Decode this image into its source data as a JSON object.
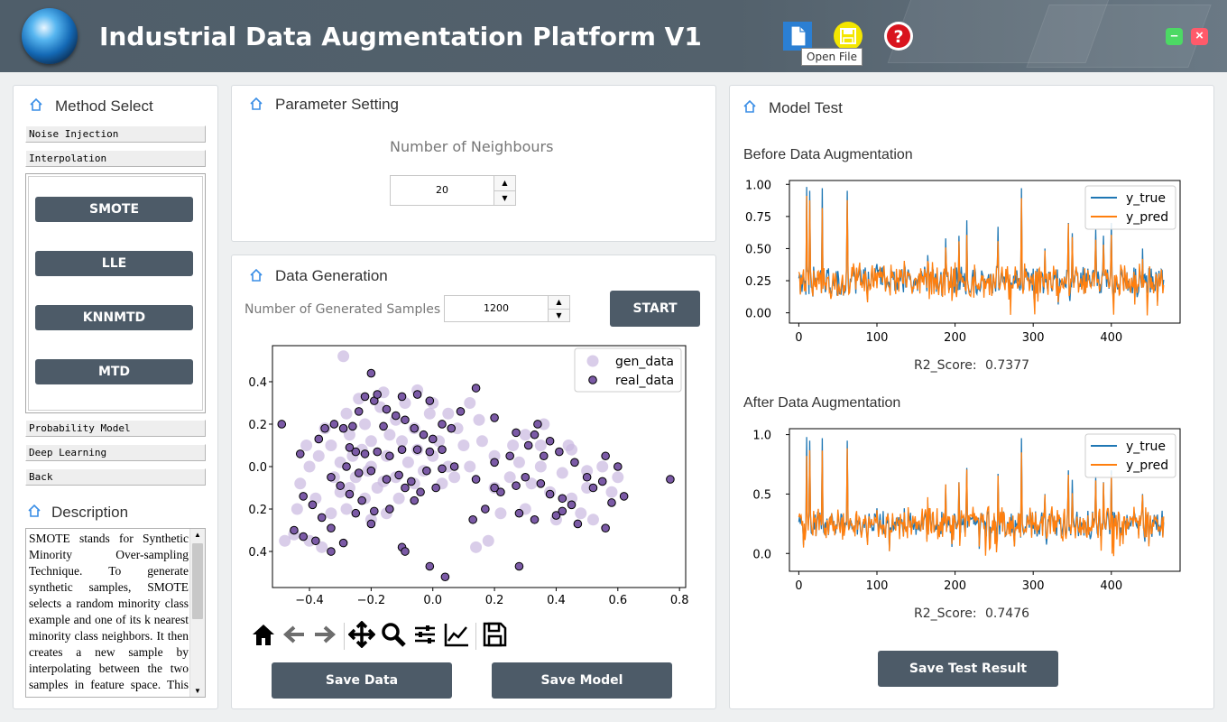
{
  "app": {
    "title": "Industrial Data Augmentation Platform V1",
    "tooltip": "Open File"
  },
  "toolbar_icons": [
    "file-icon",
    "save-icon",
    "help-icon"
  ],
  "window_controls": {
    "minimize": "–",
    "close": "×"
  },
  "method_panel": {
    "title": "Method Select",
    "sections": [
      "Noise Injection",
      "Interpolation",
      "Probability Model",
      "Deep Learning",
      "Back"
    ],
    "methods": [
      "SMOTE",
      "LLE",
      "KNNMTD",
      "MTD"
    ]
  },
  "description": {
    "title": "Description",
    "text": "SMOTE stands for Synthetic Minority Over-sampling Technique. To generate synthetic samples, SMOTE selects a random minority class example and one of its k nearest minority class neighbors. It then creates a new sample by interpolating between the two samples in feature space. This process is"
  },
  "parameter_panel": {
    "title": "Parameter Setting",
    "label": "Number of Neighbours",
    "value": "20"
  },
  "generation_panel": {
    "title": "Data Generation",
    "label": "Number of Generated Samples",
    "value": "1200",
    "start_label": "START",
    "save_data_label": "Save Data",
    "save_model_label": "Save Model"
  },
  "test_panel": {
    "title": "Model Test",
    "before_title": "Before Data Augmentation",
    "after_title": "After Data Augmentation",
    "before_score_label": "R2_Score:",
    "before_score": "0.7377",
    "after_score_label": "R2_Score:",
    "after_score": "0.7476",
    "save_label": "Save Test Result"
  },
  "nav_toolbar": [
    "home-icon",
    "back-arrow-icon",
    "forward-arrow-icon",
    "pan-icon",
    "zoom-icon",
    "configure-subplots-icon",
    "edit-axis-icon",
    "save-figure-icon"
  ],
  "colors": {
    "accent": "#4d5b68",
    "real": "#7b5aa6",
    "gen": "#c9b8e0",
    "y_true": "#1f77b4",
    "y_pred": "#ff7f0e"
  },
  "chart_data": [
    {
      "type": "scatter",
      "xlim": [
        -0.52,
        0.82
      ],
      "ylim": [
        -0.57,
        0.57
      ],
      "xticks": [
        "−0.4",
        "−0.2",
        "0.0",
        "0.2",
        "0.4",
        "0.6",
        "0.8"
      ],
      "yticks": [
        "0.4",
        "0.2",
        "0.0",
        "0.2",
        "0.4"
      ],
      "legend_position": "top-right",
      "series": [
        {
          "name": "gen_data",
          "points": [
            [
              -0.29,
              0.52
            ],
            [
              -0.41,
              0.1
            ],
            [
              -0.37,
              0.05
            ],
            [
              -0.33,
              0.1
            ],
            [
              -0.27,
              0.15
            ],
            [
              -0.23,
              0.08
            ],
            [
              -0.2,
              0.0
            ],
            [
              -0.15,
              0.05
            ],
            [
              -0.1,
              0.12
            ],
            [
              -0.05,
              0.08
            ],
            [
              0.0,
              0.05
            ],
            [
              0.05,
              0.0
            ],
            [
              0.1,
              0.1
            ],
            [
              -0.3,
              0.02
            ],
            [
              -0.25,
              -0.05
            ],
            [
              -0.18,
              -0.1
            ],
            [
              -0.12,
              -0.05
            ],
            [
              -0.08,
              0.02
            ],
            [
              -0.03,
              -0.02
            ],
            [
              0.02,
              0.12
            ],
            [
              -0.22,
              0.2
            ],
            [
              -0.17,
              0.28
            ],
            [
              -0.12,
              0.22
            ],
            [
              -0.06,
              0.18
            ],
            [
              -0.01,
              0.25
            ],
            [
              -0.28,
              0.25
            ],
            [
              -0.35,
              0.18
            ],
            [
              -0.4,
              0.0
            ],
            [
              -0.43,
              -0.08
            ],
            [
              -0.38,
              -0.15
            ],
            [
              -0.33,
              -0.22
            ],
            [
              -0.28,
              -0.2
            ],
            [
              -0.22,
              -0.15
            ],
            [
              -0.15,
              -0.22
            ],
            [
              -0.45,
              -0.32
            ],
            [
              -0.4,
              -0.35
            ],
            [
              -0.36,
              -0.38
            ],
            [
              -0.2,
              -0.25
            ],
            [
              0.0,
              0.3
            ],
            [
              0.05,
              0.25
            ],
            [
              0.08,
              0.18
            ],
            [
              0.12,
              0.0
            ],
            [
              0.15,
              0.22
            ],
            [
              -0.32,
              -0.05
            ],
            [
              -0.27,
              -0.1
            ],
            [
              -0.2,
              0.12
            ],
            [
              -0.14,
              0.15
            ],
            [
              -0.09,
              0.3
            ],
            [
              0.03,
              -0.08
            ],
            [
              0.2,
              -0.1
            ],
            [
              0.25,
              -0.05
            ],
            [
              0.28,
              0.02
            ],
            [
              0.32,
              -0.08
            ],
            [
              0.38,
              -0.12
            ],
            [
              0.42,
              -0.03
            ],
            [
              0.45,
              -0.15
            ],
            [
              0.5,
              -0.1
            ],
            [
              0.35,
              0.0
            ],
            [
              0.3,
              -0.2
            ],
            [
              0.4,
              -0.25
            ],
            [
              0.48,
              -0.22
            ],
            [
              0.22,
              -0.22
            ],
            [
              0.18,
              -0.35
            ],
            [
              0.14,
              -0.38
            ],
            [
              0.35,
              0.1
            ],
            [
              0.45,
              0.08
            ],
            [
              0.55,
              0.0
            ],
            [
              0.58,
              -0.12
            ],
            [
              0.52,
              -0.25
            ],
            [
              0.2,
              0.05
            ],
            [
              0.26,
              0.1
            ],
            [
              0.3,
              0.15
            ],
            [
              0.36,
              0.2
            ],
            [
              0.44,
              0.1
            ],
            [
              0.5,
              -0.02
            ],
            [
              0.6,
              -0.05
            ],
            [
              -0.24,
              0.32
            ],
            [
              -0.16,
              0.35
            ],
            [
              -0.05,
              0.36
            ],
            [
              0.12,
              0.3
            ],
            [
              0.16,
              0.12
            ],
            [
              -0.48,
              -0.35
            ],
            [
              -0.44,
              -0.2
            ],
            [
              -0.11,
              -0.15
            ],
            [
              -0.06,
              -0.08
            ],
            [
              0.07,
              -0.05
            ],
            [
              -0.26,
              0.05
            ],
            [
              -0.21,
              -0.02
            ],
            [
              -0.16,
              -0.07
            ],
            [
              -0.3,
              -0.12
            ]
          ]
        },
        {
          "name": "real_data",
          "points": [
            [
              -0.49,
              0.2
            ],
            [
              -0.43,
              0.06
            ],
            [
              -0.37,
              0.13
            ],
            [
              -0.32,
              0.2
            ],
            [
              -0.29,
              0.18
            ],
            [
              -0.26,
              0.19
            ],
            [
              -0.24,
              0.26
            ],
            [
              -0.19,
              0.31
            ],
            [
              -0.15,
              0.27
            ],
            [
              -0.12,
              0.24
            ],
            [
              -0.09,
              0.22
            ],
            [
              -0.06,
              0.18
            ],
            [
              -0.03,
              0.15
            ],
            [
              0.0,
              0.13
            ],
            [
              0.03,
              0.2
            ],
            [
              0.06,
              0.18
            ],
            [
              0.09,
              0.26
            ],
            [
              -0.2,
              0.44
            ],
            [
              -0.22,
              0.33
            ],
            [
              -0.18,
              0.34
            ],
            [
              -0.1,
              0.33
            ],
            [
              -0.05,
              0.34
            ],
            [
              -0.01,
              0.31
            ],
            [
              0.14,
              0.37
            ],
            [
              -0.1,
              0.08
            ],
            [
              -0.05,
              0.08
            ],
            [
              -0.01,
              0.07
            ],
            [
              0.03,
              0.08
            ],
            [
              -0.25,
              0.07
            ],
            [
              -0.22,
              0.06
            ],
            [
              -0.18,
              0.07
            ],
            [
              -0.14,
              0.05
            ],
            [
              -0.28,
              0.0
            ],
            [
              -0.24,
              -0.03
            ],
            [
              -0.2,
              -0.02
            ],
            [
              -0.15,
              -0.06
            ],
            [
              -0.11,
              -0.04
            ],
            [
              -0.07,
              -0.07
            ],
            [
              -0.02,
              -0.02
            ],
            [
              0.03,
              -0.01
            ],
            [
              0.07,
              0.0
            ],
            [
              -0.33,
              -0.05
            ],
            [
              -0.3,
              -0.09
            ],
            [
              -0.27,
              -0.13
            ],
            [
              -0.23,
              -0.16
            ],
            [
              -0.19,
              -0.21
            ],
            [
              -0.14,
              -0.2
            ],
            [
              -0.09,
              -0.1
            ],
            [
              -0.04,
              -0.12
            ],
            [
              0.01,
              -0.1
            ],
            [
              -0.42,
              -0.14
            ],
            [
              -0.39,
              -0.18
            ],
            [
              -0.36,
              -0.24
            ],
            [
              -0.33,
              -0.29
            ],
            [
              -0.45,
              -0.3
            ],
            [
              -0.42,
              -0.33
            ],
            [
              -0.38,
              -0.35
            ],
            [
              -0.33,
              -0.4
            ],
            [
              -0.29,
              -0.36
            ],
            [
              -0.25,
              -0.22
            ],
            [
              -0.2,
              -0.27
            ],
            [
              -0.1,
              -0.38
            ],
            [
              -0.09,
              -0.4
            ],
            [
              -0.01,
              -0.47
            ],
            [
              0.04,
              -0.52
            ],
            [
              0.17,
              -0.2
            ],
            [
              0.22,
              -0.12
            ],
            [
              0.27,
              -0.09
            ],
            [
              0.3,
              -0.05
            ],
            [
              0.35,
              -0.08
            ],
            [
              0.38,
              -0.13
            ],
            [
              0.42,
              -0.15
            ],
            [
              0.45,
              -0.18
            ],
            [
              0.52,
              -0.1
            ],
            [
              0.55,
              -0.07
            ],
            [
              0.58,
              -0.17
            ],
            [
              0.62,
              -0.14
            ],
            [
              0.2,
              0.02
            ],
            [
              0.25,
              0.05
            ],
            [
              0.31,
              0.1
            ],
            [
              0.33,
              0.15
            ],
            [
              0.38,
              0.12
            ],
            [
              0.41,
              0.07
            ],
            [
              0.46,
              0.02
            ],
            [
              0.5,
              -0.05
            ],
            [
              0.56,
              0.05
            ],
            [
              0.6,
              0.0
            ],
            [
              0.28,
              -0.22
            ],
            [
              0.33,
              -0.25
            ],
            [
              0.4,
              -0.23
            ],
            [
              0.42,
              -0.21
            ],
            [
              0.47,
              -0.27
            ],
            [
              0.56,
              -0.29
            ],
            [
              0.28,
              -0.47
            ],
            [
              0.77,
              -0.06
            ],
            [
              0.2,
              0.23
            ],
            [
              0.34,
              0.2
            ],
            [
              0.27,
              0.16
            ],
            [
              -0.35,
              0.18
            ],
            [
              -0.27,
              0.09
            ],
            [
              -0.16,
              0.19
            ],
            [
              -0.06,
              -0.16
            ],
            [
              0.13,
              -0.25
            ],
            [
              0.14,
              -0.06
            ],
            [
              0.2,
              -0.1
            ],
            [
              0.36,
              0.05
            ]
          ]
        }
      ]
    },
    {
      "type": "line",
      "title": "Before Data Augmentation",
      "xlim": [
        -12,
        488
      ],
      "ylim": [
        -0.08,
        1.03
      ],
      "xticks": [
        "0",
        "100",
        "200",
        "300",
        "400"
      ],
      "yticks": [
        "0.00",
        "0.25",
        "0.50",
        "0.75",
        "1.00"
      ],
      "legend_position": "top-right",
      "series": [
        {
          "name": "y_true"
        },
        {
          "name": "y_pred"
        }
      ]
    },
    {
      "type": "line",
      "title": "After Data Augmentation",
      "xlim": [
        -12,
        488
      ],
      "ylim": [
        -0.15,
        1.05
      ],
      "xticks": [
        "0",
        "100",
        "200",
        "300",
        "400"
      ],
      "yticks": [
        "0.0",
        "0.5",
        "1.0"
      ],
      "legend_position": "top-right",
      "series": [
        {
          "name": "y_true"
        },
        {
          "name": "y_pred"
        }
      ]
    }
  ]
}
